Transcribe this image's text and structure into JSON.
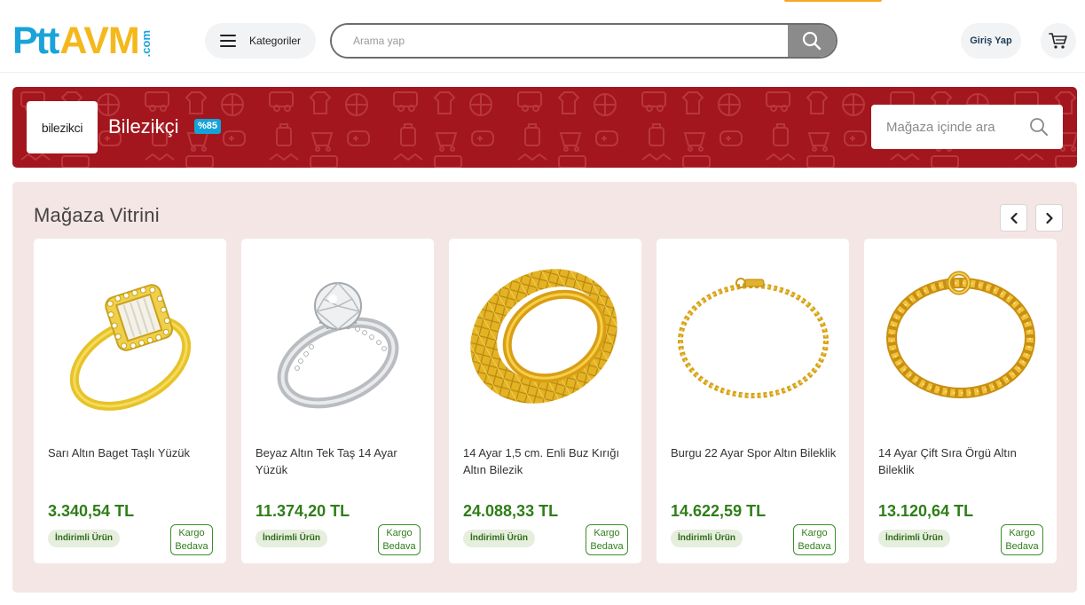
{
  "header": {
    "logo": {
      "ptt": "Ptt",
      "avm": "AVM",
      "com": ".com"
    },
    "categories_label": "Kategoriler",
    "search_placeholder": "Arama yap",
    "login_label": "Giriş Yap"
  },
  "store": {
    "logo_text": "bilezikci",
    "name": "Bilezikçi",
    "score": "%85",
    "search_placeholder": "Mağaza içinde ara"
  },
  "showcase": {
    "title": "Mağaza Vitrini",
    "products": [
      {
        "name": "Sarı Altın Baget Taşlı Yüzük",
        "price": "3.340,54 TL",
        "badge": "İndirimli Ürün",
        "cargo_line1": "Kargo",
        "cargo_line2": "Bedava",
        "image": "gold-ring-icon"
      },
      {
        "name": "Beyaz Altın Tek Taş 14 Ayar Yüzük",
        "price": "11.374,20 TL",
        "badge": "İndirimli Ürün",
        "cargo_line1": "Kargo",
        "cargo_line2": "Bedava",
        "image": "diamond-ring-icon"
      },
      {
        "name": "14 Ayar 1,5 cm. Enli Buz Kırığı Altın Bilezik",
        "price": "24.088,33 TL",
        "badge": "İndirimli Ürün",
        "cargo_line1": "Kargo",
        "cargo_line2": "Bedava",
        "image": "gold-bangle-icon"
      },
      {
        "name": "Burgu 22 Ayar Spor Altın Bileklik",
        "price": "14.622,59 TL",
        "badge": "İndirimli Ürün",
        "cargo_line1": "Kargo",
        "cargo_line2": "Bedava",
        "image": "gold-chain-bracelet-icon"
      },
      {
        "name": "14 Ayar Çift Sıra Örgü Altın Bileklik",
        "price": "13.120,64 TL",
        "badge": "İndirimli Ürün",
        "cargo_line1": "Kargo",
        "cargo_line2": "Bedava",
        "image": "gold-braided-bracelet-icon"
      }
    ]
  },
  "colors": {
    "brand_blue": "#1aa3d9",
    "brand_yellow": "#f5b81c",
    "banner_red": "#a3161d",
    "price_green": "#2f7e19",
    "showcase_bg": "#f5e6e6"
  }
}
